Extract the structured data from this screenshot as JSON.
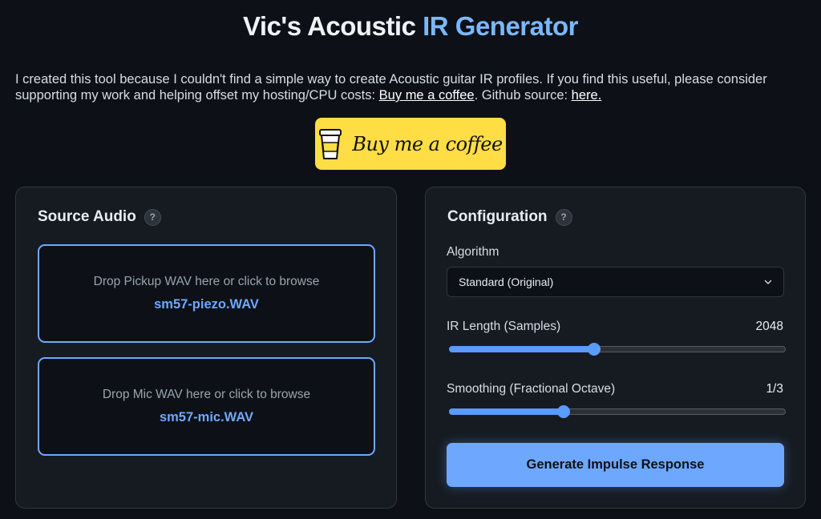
{
  "header": {
    "title_part1": "Vic's Acoustic ",
    "title_part2": "IR Generator"
  },
  "intro": {
    "text_before": "I created this tool because I couldn't find a simple way to create Acoustic guitar IR profiles. If you find this useful, please consider supporting my work and helping offset my hosting/CPU costs: ",
    "coffee_link": "Buy me a coffee",
    "text_middle": ". Github source: ",
    "github_link": "here."
  },
  "bmc_button": {
    "label": "Buy me a coffee",
    "icon": "coffee-cup-icon",
    "color": "#ffdd44"
  },
  "source_audio": {
    "title": "Source Audio",
    "help": "?",
    "pickup": {
      "hint": "Drop Pickup WAV here or click to browse",
      "file": "sm57-piezo.WAV"
    },
    "mic": {
      "hint": "Drop Mic WAV here or click to browse",
      "file": "sm57-mic.WAV"
    }
  },
  "configuration": {
    "title": "Configuration",
    "help": "?",
    "algorithm": {
      "label": "Algorithm",
      "selected": "Standard (Original)"
    },
    "ir_length": {
      "label": "IR Length (Samples)",
      "value": "2048",
      "fraction": 0.43
    },
    "smoothing": {
      "label": "Smoothing (Fractional Octave)",
      "value": "1/3",
      "fraction": 0.34
    },
    "generate_label": "Generate Impulse Response"
  },
  "colors": {
    "accent": "#6ea8fe",
    "background": "#0d1117",
    "panel": "#161b22"
  }
}
